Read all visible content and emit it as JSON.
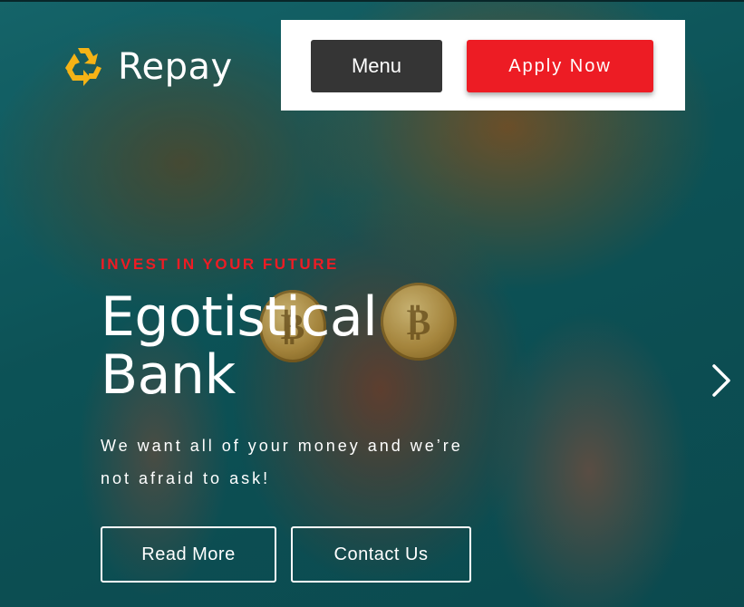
{
  "header": {
    "brand_name": "Repay",
    "logo_icon": "recycle-icon",
    "menu_label": "Menu",
    "apply_label": "Apply Now"
  },
  "hero": {
    "eyebrow": "INVEST IN YOUR FUTURE",
    "title_line1": "Egotistical",
    "title_line2": "Bank",
    "tagline_line1": "We want all of your money and we’re",
    "tagline_line2": "not afraid to ask!",
    "read_more_label": "Read More",
    "contact_label": "Contact Us",
    "next_icon": "chevron-right-icon",
    "background_image": "woman-holding-bitcoins-over-eyes"
  },
  "colors": {
    "accent_red": "#ed1c24",
    "logo_yellow": "#f5b316",
    "menu_dark": "#353535",
    "background_teal": "#0f5f63"
  }
}
